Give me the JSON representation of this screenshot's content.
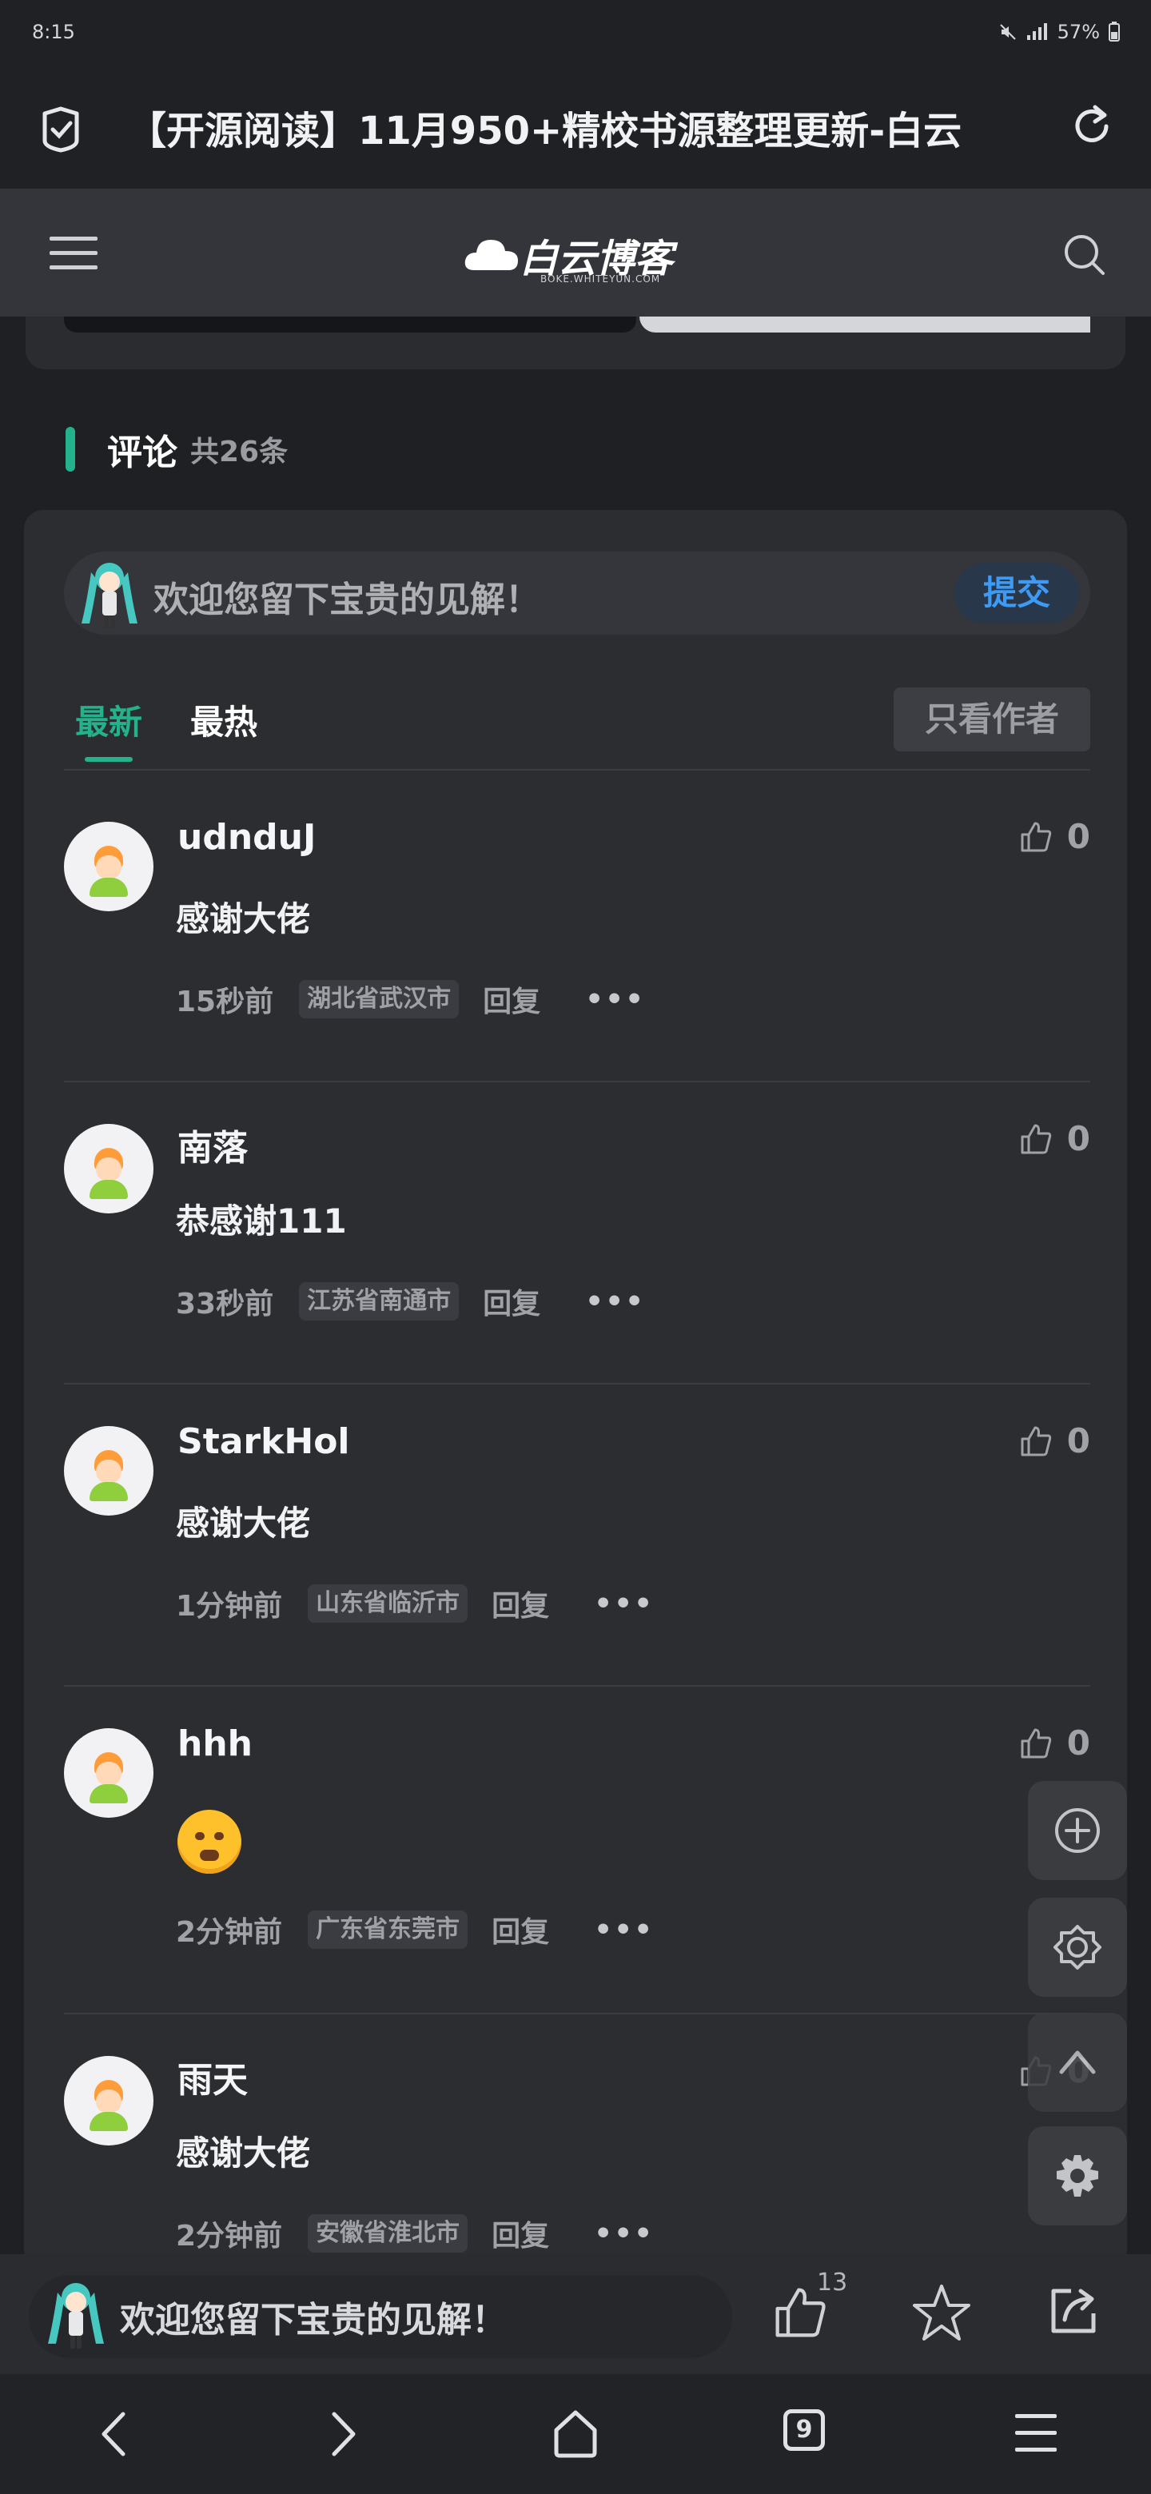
{
  "status_bar": {
    "time": "8:15",
    "battery": "57%"
  },
  "url_bar": {
    "title": "【开源阅读】11月950+精校书源整理更新-白云"
  },
  "site": {
    "logo_text": "白云博客",
    "logo_sub": "BOKE.WHITEYUN.COM"
  },
  "comments": {
    "heading": "评论",
    "count_label": "共26条",
    "input_placeholder": "欢迎您留下宝贵的见解！",
    "submit_label": "提交",
    "tabs": [
      {
        "label": "最新"
      },
      {
        "label": "最热"
      }
    ],
    "only_author_label": "只看作者",
    "items": [
      {
        "name": "udnduJ",
        "text": "感谢大佬",
        "time": "15秒前",
        "location": "湖北省武汉市",
        "reply": "回复",
        "more": "•••",
        "likes": "0"
      },
      {
        "name": "南落",
        "text": "恭感谢111",
        "time": "33秒前",
        "location": "江苏省南通市",
        "reply": "回复",
        "more": "•••",
        "likes": "0"
      },
      {
        "name": "StarkHol",
        "text": "感谢大佬",
        "time": "1分钟前",
        "location": "山东省临沂市",
        "reply": "回复",
        "more": "•••",
        "likes": "0"
      },
      {
        "name": "hhh",
        "text": "",
        "emoji": "angry-face-emoji",
        "time": "2分钟前",
        "location": "广东省东莞市",
        "reply": "回复",
        "more": "•••",
        "likes": "0"
      },
      {
        "name": "雨天",
        "text": "感谢大佬",
        "time": "2分钟前",
        "location": "安徽省淮北市",
        "reply": "回复",
        "more": "•••",
        "likes": "0"
      }
    ]
  },
  "bottom_bar": {
    "placeholder": "欢迎您留下宝贵的见解！",
    "like_count": "13"
  },
  "nav_bar": {
    "tab_count": "9"
  },
  "colors": {
    "accent": "#23b28b",
    "submit_blue": "#3d9bf5",
    "background": "#1f2024",
    "card": "#2c2d31"
  }
}
